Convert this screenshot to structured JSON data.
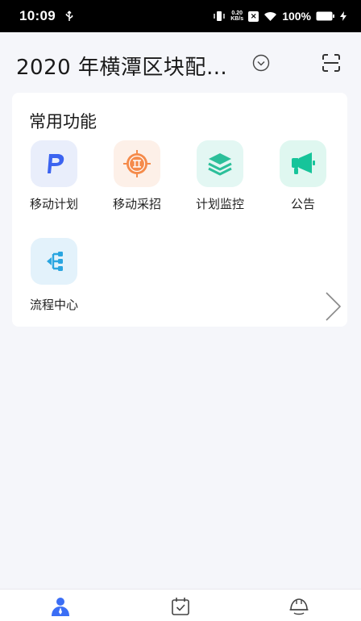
{
  "status_bar": {
    "time": "10:09",
    "net_speed_value": "0.20",
    "net_speed_unit": "KB/s",
    "battery": "100%"
  },
  "header": {
    "title": "2020 年横潭区块配…"
  },
  "card": {
    "title": "常用功能",
    "items": [
      {
        "label": "移动计划",
        "icon": "p-icon"
      },
      {
        "label": "移动采招",
        "icon": "target-icon"
      },
      {
        "label": "计划监控",
        "icon": "layers-icon"
      },
      {
        "label": "公告",
        "icon": "megaphone-icon"
      },
      {
        "label": "流程中心",
        "icon": "flow-icon"
      }
    ]
  },
  "bottom_nav": [
    {
      "icon": "user-icon",
      "active": true
    },
    {
      "icon": "calendar-check-icon",
      "active": false
    },
    {
      "icon": "helmet-icon",
      "active": false
    }
  ],
  "colors": {
    "accent": "#3b6ef5",
    "background": "#f5f6fa"
  }
}
